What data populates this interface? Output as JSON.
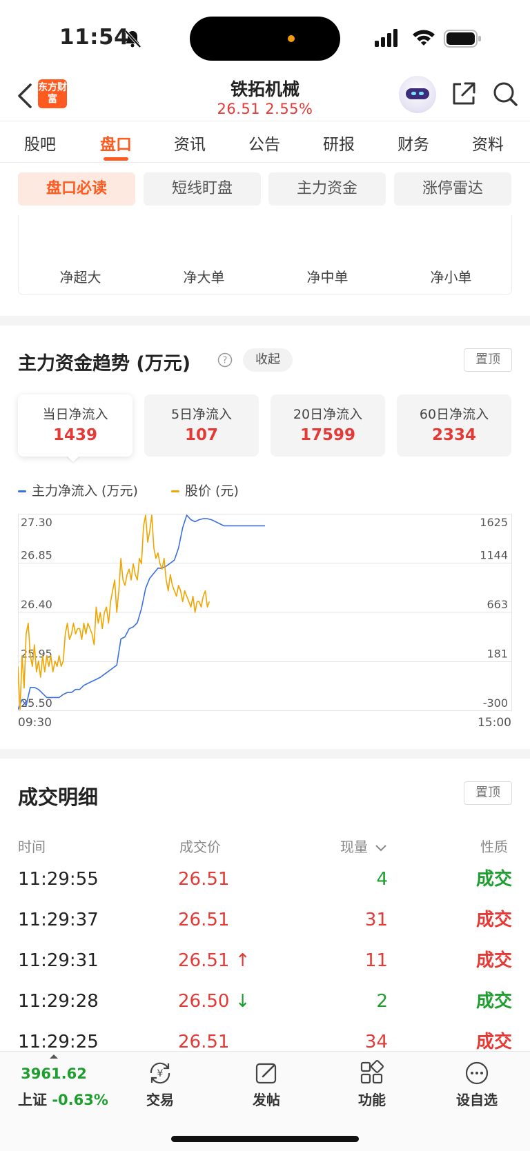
{
  "status_bar": {
    "time": "11:54"
  },
  "header": {
    "logo_text": "东方财富",
    "stock_name": "铁拓机械",
    "price_line": "26.51  2.55%"
  },
  "tabs": [
    {
      "label": "股吧"
    },
    {
      "label": "盘口"
    },
    {
      "label": "资讯"
    },
    {
      "label": "公告"
    },
    {
      "label": "研报"
    },
    {
      "label": "财务"
    },
    {
      "label": "资料"
    }
  ],
  "active_tab": "盘口",
  "chips": [
    {
      "label": "盘口必读"
    },
    {
      "label": "短线盯盘"
    },
    {
      "label": "主力资金"
    },
    {
      "label": "涨停雷达"
    }
  ],
  "netflow": {
    "labels": [
      "净超大",
      "净大单",
      "净中单",
      "净小单"
    ]
  },
  "trend": {
    "title": "主力资金趋势 (万元)",
    "collapse_label": "收起",
    "pin_label": "置顶",
    "periods": [
      {
        "label": "当日净流入",
        "value": "1439"
      },
      {
        "label": "5日净流入",
        "value": "107"
      },
      {
        "label": "20日净流入",
        "value": "17599"
      },
      {
        "label": "60日净流入",
        "value": "2334"
      }
    ],
    "legend": [
      {
        "label": "主力净流入 (万元)",
        "color": "#3a6fe0"
      },
      {
        "label": "股价 (元)",
        "color": "#f0a500"
      }
    ],
    "time_start": "09:30",
    "time_end": "15:00"
  },
  "chart_data": {
    "type": "line",
    "x_range": [
      "09:30",
      "15:00"
    ],
    "left_axis_ticks": [
      "27.30",
      "26.85",
      "26.40",
      "25.95",
      "25.50"
    ],
    "right_axis_ticks": [
      "1625",
      "1144",
      "663",
      "181",
      "-300"
    ],
    "ylim_left": [
      25.5,
      27.3
    ],
    "ylim_right": [
      -300,
      1625
    ],
    "series": [
      {
        "name": "主力净流入 (万元)",
        "axis": "right",
        "color": "#3a6fe0",
        "x_minutes": [
          0,
          2,
          4,
          6,
          8,
          10,
          12,
          14,
          16,
          18,
          20,
          22,
          24,
          26,
          28,
          30,
          32,
          34,
          36,
          38,
          40,
          42,
          44,
          46,
          48,
          50,
          52,
          54,
          56,
          58,
          60,
          62,
          64,
          66,
          68,
          70,
          72,
          74,
          76,
          78,
          80,
          82,
          84,
          86,
          88,
          90,
          92,
          94,
          96,
          98,
          100,
          102,
          104,
          106,
          108,
          110,
          112,
          114,
          116,
          118,
          120
        ],
        "values": [
          -300,
          -200,
          -260,
          -80,
          -80,
          -100,
          -140,
          -180,
          -180,
          -180,
          -180,
          -150,
          -130,
          -130,
          -100,
          -100,
          -60,
          -40,
          -20,
          0,
          20,
          50,
          80,
          110,
          140,
          400,
          420,
          500,
          520,
          560,
          700,
          900,
          1000,
          1050,
          1100,
          1100,
          1120,
          1150,
          1180,
          1300,
          1500,
          1625,
          1580,
          1560,
          1580,
          1590,
          1590,
          1580,
          1560,
          1540,
          1520,
          1520,
          1520,
          1520,
          1520,
          1520,
          1520,
          1520,
          1520,
          1520,
          1520
        ]
      },
      {
        "name": "股价 (元)",
        "axis": "left",
        "color": "#f0a500",
        "x_minutes": [
          0,
          1,
          2,
          3,
          4,
          5,
          6,
          7,
          8,
          9,
          10,
          11,
          12,
          13,
          14,
          15,
          16,
          17,
          18,
          19,
          20,
          21,
          22,
          23,
          24,
          25,
          26,
          27,
          28,
          29,
          30,
          31,
          32,
          33,
          34,
          35,
          36,
          37,
          38,
          39,
          40,
          41,
          42,
          43,
          44,
          45,
          46,
          47,
          48,
          49,
          50,
          51,
          52,
          53,
          54,
          55,
          56,
          57,
          58,
          59,
          60,
          61,
          62,
          63,
          64,
          65,
          66,
          67,
          68,
          69,
          70,
          71,
          72,
          73,
          74,
          75,
          76,
          77,
          78,
          79,
          80,
          81,
          82,
          83,
          84,
          85,
          86,
          87,
          88,
          89,
          90,
          91,
          92,
          93,
          94,
          95,
          96,
          97,
          98,
          99,
          100,
          101,
          102,
          103,
          104,
          105,
          106,
          107,
          108,
          109,
          110,
          111,
          112,
          113,
          114,
          115,
          116,
          117,
          118,
          119,
          120
        ],
        "values": [
          25.9,
          25.5,
          26.0,
          25.7,
          26.2,
          26.3,
          26.0,
          25.9,
          26.1,
          25.85,
          25.95,
          25.8,
          26.0,
          25.85,
          26.0,
          25.9,
          26.0,
          25.85,
          25.95,
          25.9,
          26.0,
          25.9,
          25.95,
          26.2,
          26.3,
          26.15,
          26.2,
          26.3,
          26.2,
          26.25,
          26.25,
          26.15,
          26.3,
          26.2,
          26.3,
          26.25,
          26.2,
          26.1,
          26.45,
          26.3,
          26.4,
          26.25,
          26.4,
          26.45,
          26.3,
          26.5,
          26.6,
          26.7,
          26.4,
          26.6,
          26.9,
          26.7,
          26.65,
          26.75,
          26.8,
          26.7,
          26.85,
          26.75,
          26.7,
          26.9,
          26.85,
          27.2,
          27.3,
          27.05,
          27.15,
          27.3,
          27.0,
          26.9,
          26.95,
          26.85,
          26.8,
          26.9,
          26.7,
          26.6,
          26.75,
          26.65,
          26.6,
          26.55,
          26.65,
          26.6,
          26.5,
          26.6,
          26.55,
          26.5,
          26.45,
          26.55,
          26.4,
          26.5,
          26.5,
          26.45,
          26.55,
          26.6,
          26.45,
          26.5
        ],
        "note_len": 94
      }
    ]
  },
  "detail": {
    "title": "成交明细",
    "pin_label": "置顶",
    "headers": {
      "time": "时间",
      "price": "成交价",
      "volume": "现量",
      "nature": "性质"
    },
    "rows": [
      {
        "time": "11:29:55",
        "price": "26.51",
        "arrow": "",
        "volume": "4",
        "vol_color": "green",
        "nature": "成交",
        "nature_color": "green"
      },
      {
        "time": "11:29:37",
        "price": "26.51",
        "arrow": "",
        "volume": "31",
        "vol_color": "red",
        "nature": "成交",
        "nature_color": "red"
      },
      {
        "time": "11:29:31",
        "price": "26.51",
        "arrow": "↑",
        "volume": "11",
        "vol_color": "red",
        "nature": "成交",
        "nature_color": "red"
      },
      {
        "time": "11:29:28",
        "price": "26.50",
        "arrow": "↓",
        "volume": "2",
        "vol_color": "green",
        "nature": "成交",
        "nature_color": "green"
      },
      {
        "time": "11:29:25",
        "price": "26.51",
        "arrow": "",
        "volume": "34",
        "vol_color": "red",
        "nature": "成交",
        "nature_color": "red"
      }
    ]
  },
  "bottom_bar": {
    "index_value": "3961.62",
    "index_name": "上证",
    "index_change": "-0.63%",
    "nav": [
      {
        "label": "交易",
        "icon": "trade-yen-icon"
      },
      {
        "label": "发帖",
        "icon": "compose-icon"
      },
      {
        "label": "功能",
        "icon": "grid-icon"
      },
      {
        "label": "设自选",
        "icon": "more-icon"
      }
    ]
  }
}
